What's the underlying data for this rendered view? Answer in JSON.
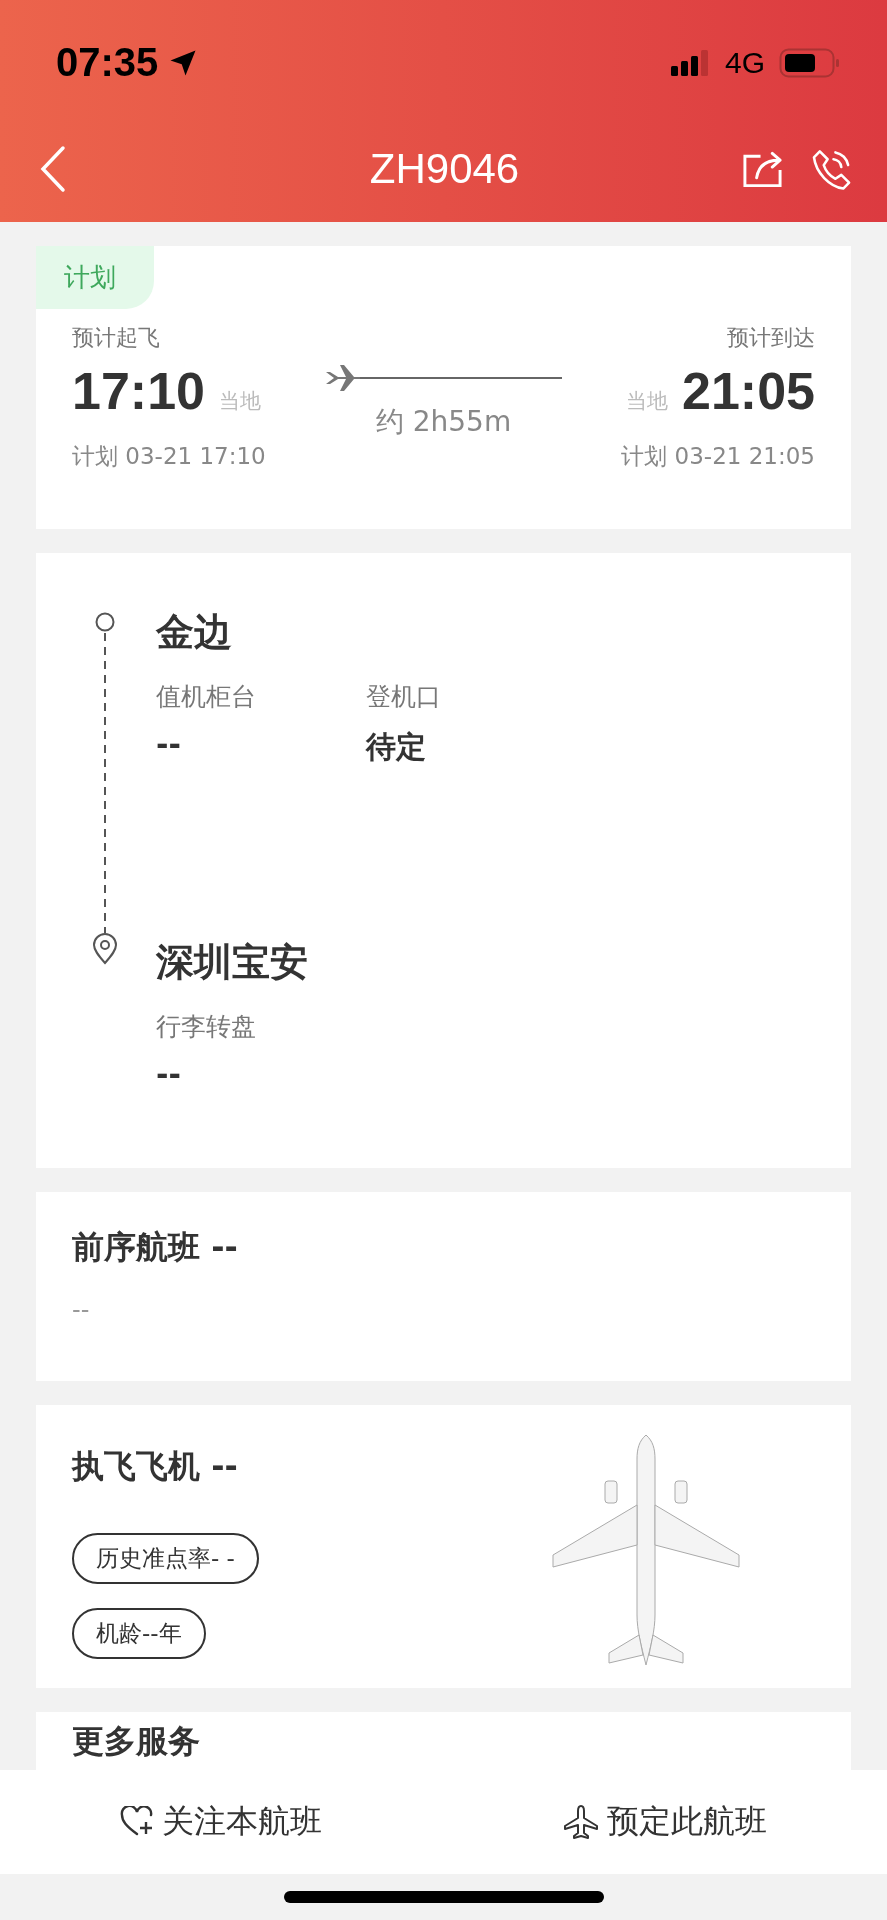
{
  "status_bar": {
    "time": "07:35",
    "network": "4G"
  },
  "nav": {
    "title": "ZH9046"
  },
  "flight": {
    "status": "计划",
    "duration": "约 2h55m",
    "departure": {
      "label": "预计起飞",
      "time": "17:10",
      "zone": "当地",
      "planned": "计划 03-21 17:10"
    },
    "arrival": {
      "label": "预计到达",
      "time": "21:05",
      "zone": "当地",
      "planned": "计划 03-21 21:05"
    }
  },
  "route": {
    "origin": {
      "city": "金边",
      "fields": [
        {
          "label": "值机柜台",
          "value": "--"
        },
        {
          "label": "登机口",
          "value": "待定"
        }
      ]
    },
    "destination": {
      "city": "深圳宝安",
      "fields": [
        {
          "label": "行李转盘",
          "value": "--"
        }
      ]
    }
  },
  "previous_flight": {
    "title": "前序航班 --",
    "detail": "--"
  },
  "aircraft": {
    "title": "执飞飞机 --",
    "tags": [
      "历史准点率- -",
      "机龄--年"
    ]
  },
  "more_services": {
    "title": "更多服务"
  },
  "actions": [
    {
      "kind": "follow",
      "label": "关注本航班"
    },
    {
      "kind": "book",
      "label": "预定此航班"
    }
  ]
}
